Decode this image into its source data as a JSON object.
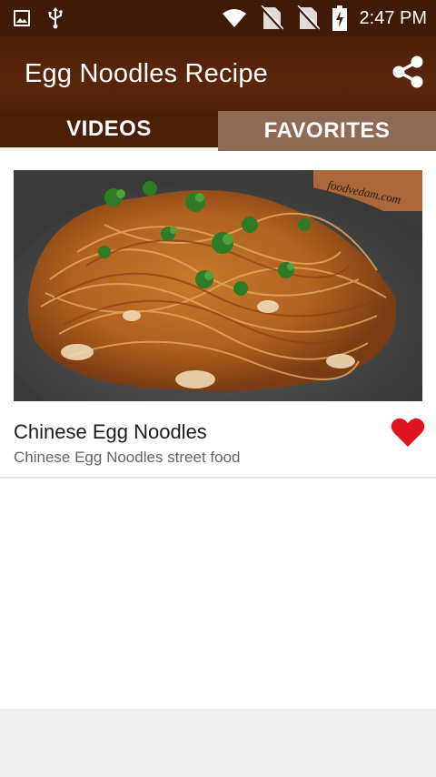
{
  "status_bar": {
    "time": "2:47 PM",
    "icons": [
      "image-icon",
      "usb-icon",
      "wifi-icon",
      "no-sim-icon",
      "no-sim-icon",
      "battery-charging-icon"
    ]
  },
  "app_bar": {
    "title": "Egg Noodles Recipe",
    "action_icon": "share-icon"
  },
  "tabs": [
    {
      "label": "VIDEOS",
      "active": true
    },
    {
      "label": "FAVORITES",
      "active": false
    }
  ],
  "videos": [
    {
      "title": "Chinese Egg Noodles",
      "subtitle": "Chinese Egg Noodles street food",
      "watermark": "foodvedam.com",
      "favorite": true
    }
  ],
  "colors": {
    "status_bar": "#3f1a06",
    "app_bar": "#5a260b",
    "tab_active": "#4a1f08",
    "tab_inactive": "#8f6a55",
    "favorite": "#e0141e"
  }
}
